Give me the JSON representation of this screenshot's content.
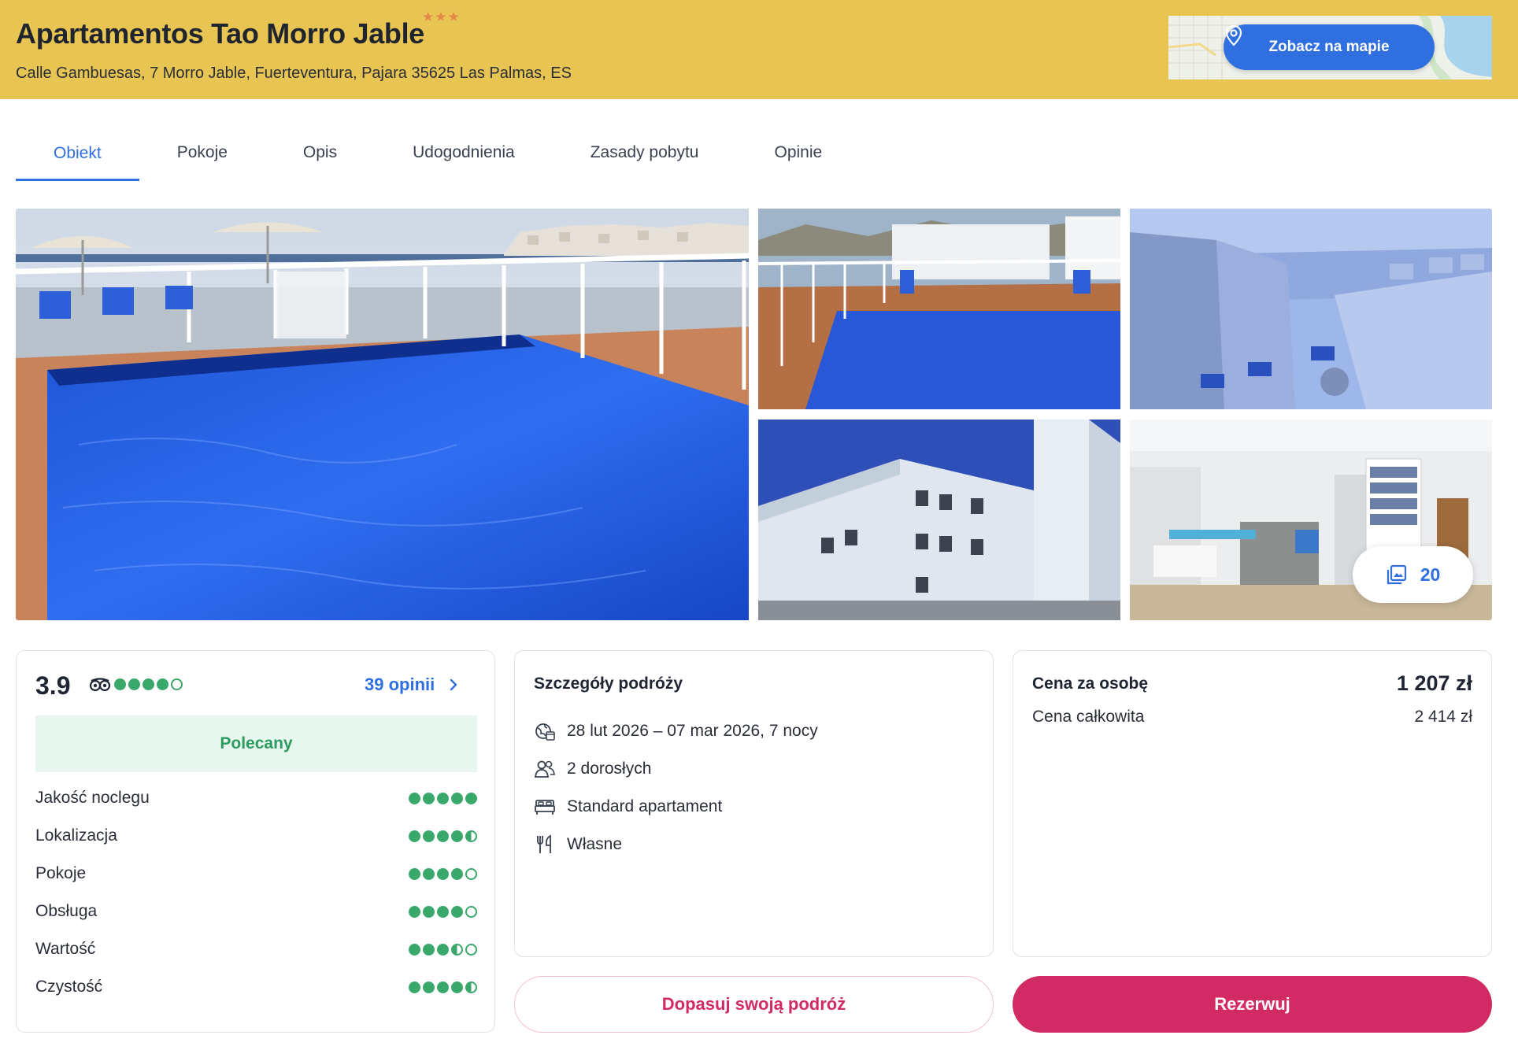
{
  "header": {
    "title": "Apartamentos Tao Morro Jable",
    "stars": "★★★",
    "address": "Calle Gambuesas, 7 Morro Jable, Fuerteventura, Pajara 35625 Las Palmas, ES",
    "map_button": "Zobacz na mapie"
  },
  "tabs": [
    {
      "label": "Obiekt",
      "active": true
    },
    {
      "label": "Pokoje"
    },
    {
      "label": "Opis"
    },
    {
      "label": "Udogodnienia"
    },
    {
      "label": "Zasady pobytu"
    },
    {
      "label": "Opinie"
    }
  ],
  "gallery": {
    "photo_count": "20"
  },
  "rating": {
    "score": "3.9",
    "score_dots": 4.0,
    "reviews_link": "39 opinii",
    "badge": "Polecany",
    "categories": [
      {
        "label": "Jakość noclegu",
        "value": 5.0
      },
      {
        "label": "Lokalizacja",
        "value": 4.5
      },
      {
        "label": "Pokoje",
        "value": 4.0
      },
      {
        "label": "Obsługa",
        "value": 4.0
      },
      {
        "label": "Wartość",
        "value": 3.5
      },
      {
        "label": "Czystość",
        "value": 4.5
      }
    ]
  },
  "trip": {
    "title": "Szczegóły podróży",
    "dates": "28 lut 2026 – 07 mar 2026, 7 nocy",
    "guests": "2 dorosłych",
    "room": "Standard apartament",
    "board": "Własne"
  },
  "price": {
    "per_person_label": "Cena za osobę",
    "per_person_value": "1 207 zł",
    "total_label": "Cena całkowita",
    "total_value": "2 414 zł"
  },
  "actions": {
    "customize": "Dopasuj swoją podróż",
    "book": "Rezerwuj"
  },
  "colors": {
    "header_bg": "#e8c552",
    "accent_blue": "#2f6fe0",
    "rating_green": "#3aa86b",
    "book_pink": "#d12a65"
  }
}
